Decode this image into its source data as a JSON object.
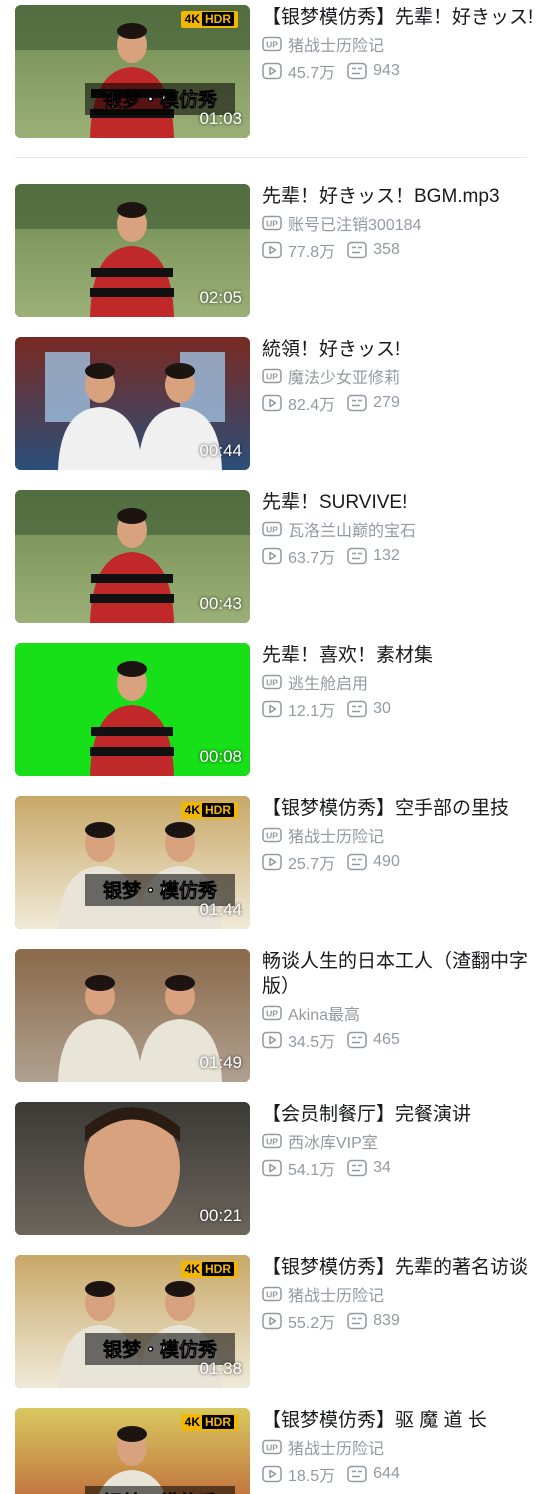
{
  "colors": {
    "title": "#18191c",
    "meta": "#9499a0",
    "badge_bg": "#f2b705",
    "divider": "#e3e5e7"
  },
  "icons": {
    "up": "up-icon",
    "views": "play-views-icon",
    "danmaku": "danmaku-icon"
  },
  "videos": [
    {
      "title": "【银梦模仿秀】先辈！好きッス!",
      "uploader": "猪战士历险记",
      "views": "45.7万",
      "danmaku": "943",
      "duration": "01:03",
      "badge": "4K",
      "badge_hdr": "HDR",
      "thumb_text": "银梦・模仿秀",
      "thumb_style": "field"
    },
    {
      "title": "先辈！好きッス！BGM.mp3",
      "uploader": "账号已注销300184",
      "views": "77.8万",
      "danmaku": "358",
      "duration": "02:05",
      "thumb_style": "field"
    },
    {
      "title": "統領！好きッス!",
      "uploader": "魔法少女亚修莉",
      "views": "82.4万",
      "danmaku": "279",
      "duration": "00:44",
      "thumb_style": "office"
    },
    {
      "title": "先辈！SURVIVE!",
      "uploader": "瓦洛兰山巅的宝石",
      "views": "63.7万",
      "danmaku": "132",
      "duration": "00:43",
      "thumb_style": "field"
    },
    {
      "title": "先辈！喜欢！素材集",
      "uploader": "逃生舱启用",
      "views": "12.1万",
      "danmaku": "30",
      "duration": "00:08",
      "thumb_style": "green"
    },
    {
      "title": "【银梦模仿秀】空手部の里技",
      "uploader": "猪战士历险记",
      "views": "25.7万",
      "danmaku": "490",
      "duration": "01:44",
      "badge": "4K",
      "badge_hdr": "HDR",
      "thumb_text": "银梦・模仿秀",
      "thumb_style": "room"
    },
    {
      "title": "畅谈人生的日本工人（渣翻中字版）",
      "uploader": "Akina最高",
      "views": "34.5万",
      "danmaku": "465",
      "duration": "01:49",
      "thumb_style": "outdoor"
    },
    {
      "title": "【会员制餐厅】完餐演讲",
      "uploader": "西冰库VIP室",
      "views": "54.1万",
      "danmaku": "34",
      "duration": "00:21",
      "thumb_style": "face"
    },
    {
      "title": "【银梦模仿秀】先辈的著名访谈",
      "uploader": "猪战士历险记",
      "views": "55.2万",
      "danmaku": "839",
      "duration": "01:38",
      "badge": "4K",
      "badge_hdr": "HDR",
      "thumb_text": "银梦・模仿秀",
      "thumb_style": "room"
    },
    {
      "title": "【银梦模仿秀】驱 魔 道 长",
      "uploader": "猪战士历险记",
      "views": "18.5万",
      "danmaku": "644",
      "duration": "",
      "badge": "4K",
      "badge_hdr": "HDR",
      "thumb_text": "银梦・模仿秀",
      "thumb_style": "festival"
    }
  ]
}
